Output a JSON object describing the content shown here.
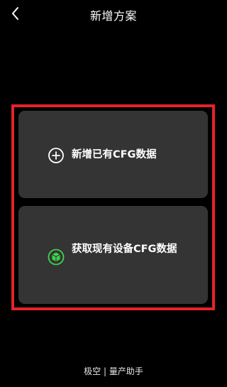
{
  "header": {
    "title": "新增方案",
    "back_icon": "chevron-left-icon"
  },
  "options": [
    {
      "label": "新增已有CFG数据",
      "icon": "plus-circle-icon",
      "icon_color": "#ffffff"
    },
    {
      "label": "获取现有设备CFG数据",
      "icon": "box-download-icon",
      "icon_color": "#3cd54a"
    }
  ],
  "highlight_color": "#e5222b",
  "footer": {
    "text": "极空 | 量产助手"
  }
}
